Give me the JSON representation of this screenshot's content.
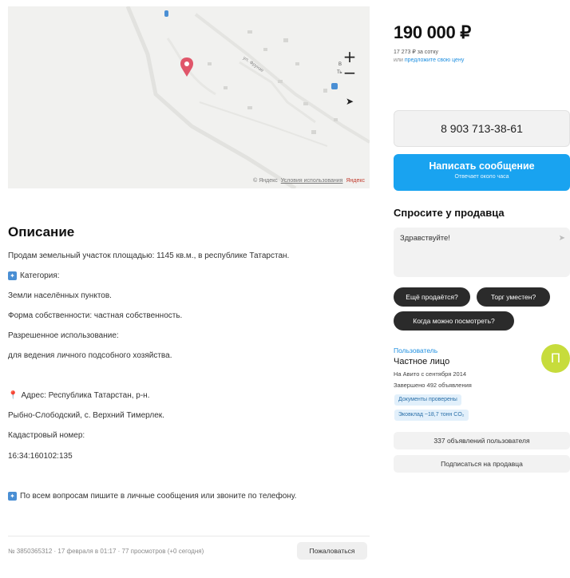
{
  "map": {
    "street_label": "ул. Фрунзе",
    "zoom_in": "+",
    "zoom_out": "−",
    "compass_letters": [
      "В",
      "Ть"
    ],
    "copyright": "© Яндекс",
    "terms_link": "Условия использования",
    "brand": "Яндекс"
  },
  "description": {
    "title": "Описание",
    "lines": [
      "Продам земельный участок площадью: 1145 кв.м., в республике Татарстан.",
      "Категория:",
      "Земли населённых пунктов.",
      "Форма собственности: частная собственность.",
      "Разрешенное использование:",
      "для ведения личного подсобного хозяйства.",
      "Адрес: Республика Татарстан, р-н.",
      "Рыбно-Слободский, с. Верхний Тимерлек.",
      "Кадастровый номер:",
      "16:34:160102:135",
      "По всем вопросам пишите в личные сообщения или звоните по телефону."
    ]
  },
  "footer": {
    "meta": "№ 3850365312 · 17 февраля в 01:17 · 77 просмотров (+0 сегодня)",
    "report_label": "Пожаловаться"
  },
  "price": {
    "value": "190 000 ₽",
    "per_sotka": "17 273 ₽ за сотку",
    "offer_prefix": "или ",
    "offer_link": "предложите свою цену"
  },
  "contact": {
    "phone": "8 903 713-38-61",
    "message_label": "Написать сообщение",
    "message_sub": "Отвечает около часа"
  },
  "ask": {
    "title": "Спросите у продавца",
    "input_value": "Здравствуйте!",
    "chips": [
      "Ещё продаётся?",
      "Торг уместен?",
      "Когда можно посмотреть?"
    ]
  },
  "seller": {
    "type": "Пользователь",
    "name": "Частное лицо",
    "since": "На Авито с сентября 2014",
    "completed": "Завершено 492 объявления",
    "badge_docs": "Документы проверены",
    "badge_eco": "Эковклад ~18,7 тонн CO₂",
    "avatar_letter": "П",
    "listings_button": "337 объявлений пользователя",
    "subscribe_button": "Подписаться на продавца"
  },
  "colors": {
    "accent_blue": "#19a3f0",
    "link_blue": "#1e8fe0",
    "avatar": "#c7dc3c",
    "map_pin": "#e0566a"
  }
}
